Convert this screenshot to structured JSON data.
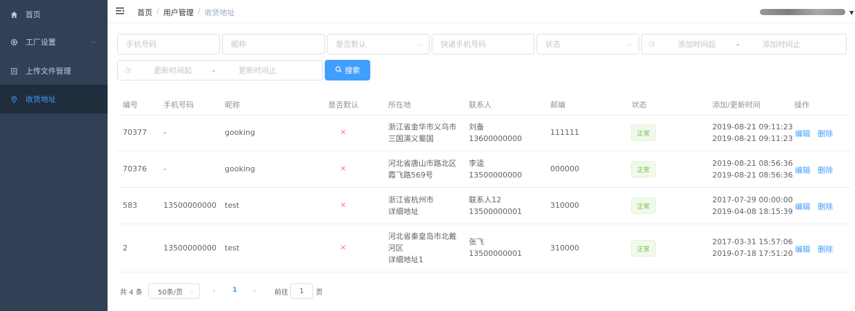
{
  "sidebar": {
    "items": [
      {
        "icon": "home-icon",
        "label": "首页",
        "active": false
      },
      {
        "icon": "gear-icon",
        "label": "工厂设置",
        "active": false
      },
      {
        "icon": "document-icon",
        "label": "上传文件管理",
        "active": false
      },
      {
        "icon": "location-icon",
        "label": "收货地址",
        "active": true
      }
    ],
    "bg": "#304156",
    "active_color": "#409eff"
  },
  "navbar": {
    "breadcrumb": [
      "首页",
      "用户管理",
      "收货地址"
    ],
    "separator": "/"
  },
  "filters": {
    "phone_placeholder": "手机号码",
    "nickname_placeholder": "昵称",
    "is_default_placeholder": "是否默认",
    "express_phone_placeholder": "快递手机号码",
    "status_placeholder": "状态",
    "add_time_start": "添加时间起",
    "add_time_end": "添加时间止",
    "update_time_start": "更新时间起",
    "update_time_end": "更新时间止",
    "range_sep": "-",
    "search_label": "搜索"
  },
  "table": {
    "columns": [
      "编号",
      "手机号码",
      "昵称",
      "是否默认",
      "所在地",
      "联系人",
      "邮编",
      "状态",
      "添加/更新时间",
      "操作"
    ],
    "rows": [
      {
        "id": "70377",
        "phone": "-",
        "nickname": "gooking",
        "is_default": "×",
        "location": [
          "浙江省金华市义乌市",
          "三国演义蜀国"
        ],
        "contact": [
          "刘备",
          "13600000000"
        ],
        "zip": "111111",
        "status": "正常",
        "times": [
          "2019-08-21 09:11:23",
          "2019-08-21 09:11:23"
        ]
      },
      {
        "id": "70376",
        "phone": "-",
        "nickname": "gooking",
        "is_default": "×",
        "location": [
          "河北省唐山市路北区",
          "霞飞路569号"
        ],
        "contact": [
          "李逵",
          "13500000000"
        ],
        "zip": "000000",
        "status": "正常",
        "times": [
          "2019-08-21 08:56:36",
          "2019-08-21 08:56:36"
        ]
      },
      {
        "id": "583",
        "phone": "13500000000",
        "nickname": "test",
        "is_default": "×",
        "location": [
          "浙江省杭州市",
          "详细地址"
        ],
        "contact": [
          "联系人12",
          "13500000001"
        ],
        "zip": "310000",
        "status": "正常",
        "times": [
          "2017-07-29 00:00:00",
          "2019-04-08 18:15:39"
        ]
      },
      {
        "id": "2",
        "phone": "13500000000",
        "nickname": "test",
        "is_default": "×",
        "location": [
          "河北省秦皇岛市北戴",
          "河区",
          "详细地址1"
        ],
        "contact": [
          "张飞",
          "13500000001"
        ],
        "zip": "310000",
        "status": "正常",
        "times": [
          "2017-03-31 15:57:06",
          "2019-07-18 17:51:20"
        ]
      }
    ],
    "actions": {
      "edit": "编辑",
      "delete": "删除"
    }
  },
  "pagination": {
    "total": "共 4 条",
    "page_size": "50条/页",
    "current": "1",
    "goto_label": "前往",
    "goto_value": "1",
    "page_suffix": "页"
  },
  "colors": {
    "primary": "#409eff",
    "danger": "#f56c6c",
    "success": "#67c23a"
  }
}
